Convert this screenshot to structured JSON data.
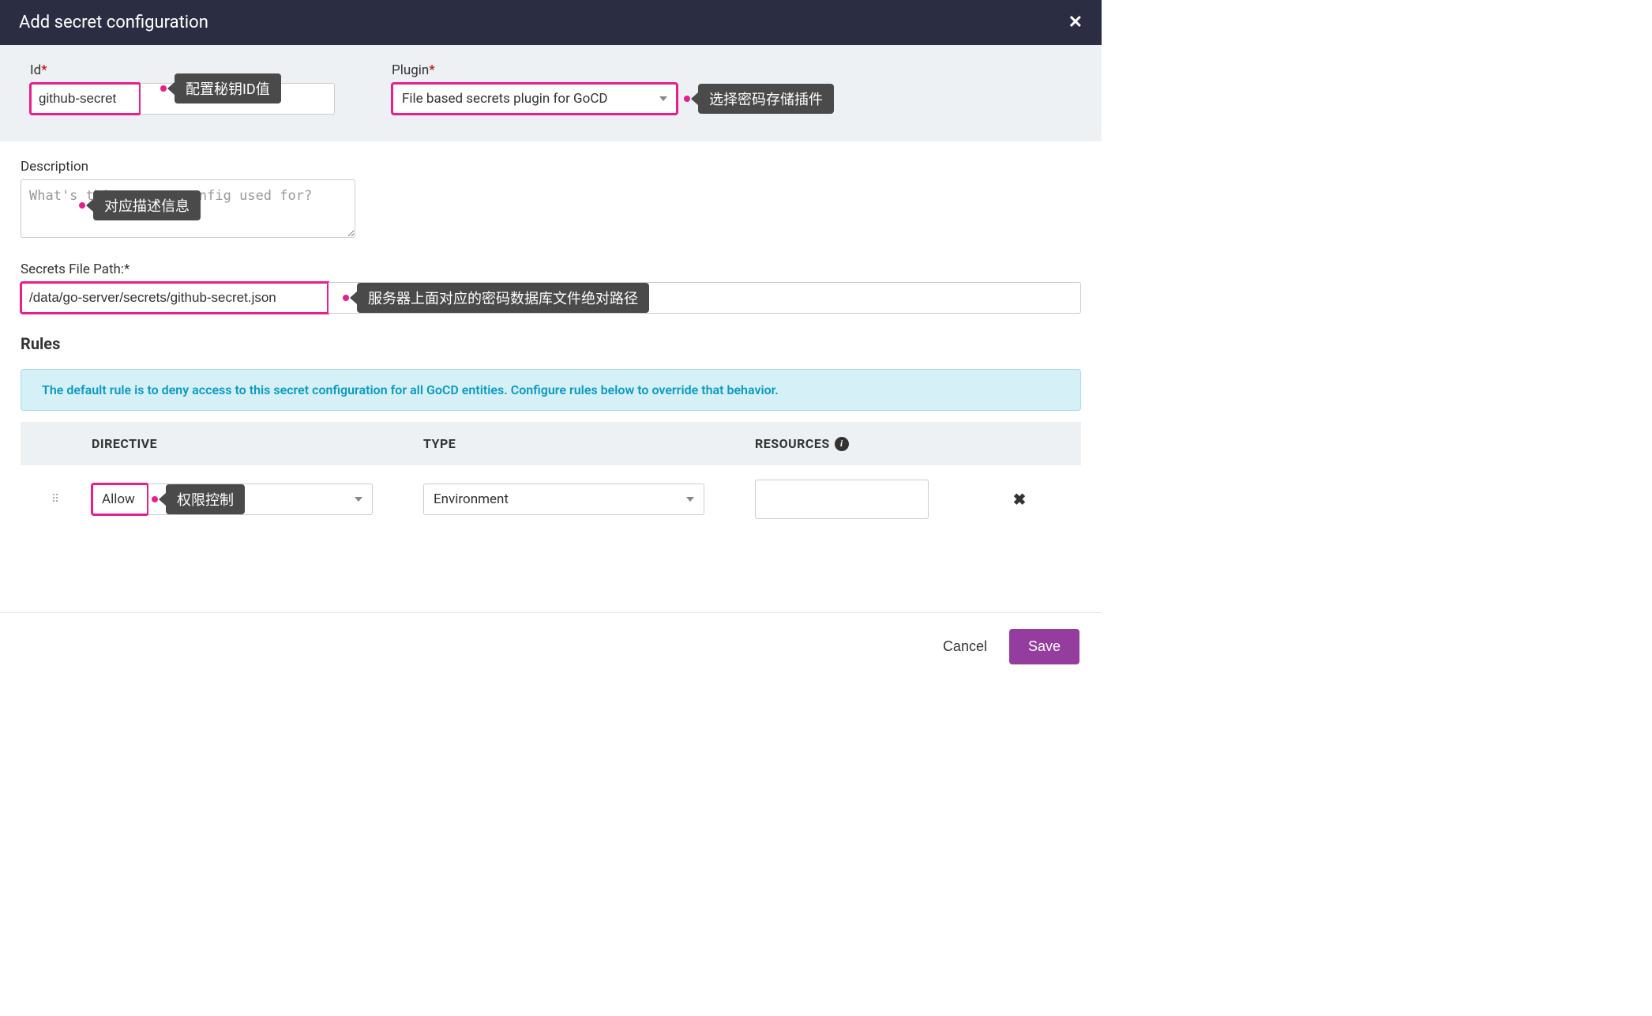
{
  "modal": {
    "title": "Add secret configuration",
    "close_icon": "✕"
  },
  "fields": {
    "id": {
      "label": "Id",
      "required_mark": "*",
      "value": "github-secret",
      "annotation": "配置秘钥ID值"
    },
    "plugin": {
      "label": "Plugin",
      "required_mark": "*",
      "selected": "File based secrets plugin for GoCD",
      "annotation": "选择密码存储插件"
    },
    "description": {
      "label": "Description",
      "placeholder": "What's this secret config used for?",
      "value": "",
      "annotation": "对应描述信息"
    },
    "secrets_file_path": {
      "label": "Secrets File Path:*",
      "value": "/data/go-server/secrets/github-secret.json",
      "annotation": "服务器上面对应的密码数据库文件绝对路径"
    }
  },
  "rules": {
    "heading": "Rules",
    "info": "The default rule is to deny access to this secret configuration for all GoCD entities. Configure rules below to override that behavior.",
    "columns": {
      "directive": "DIRECTIVE",
      "type": "TYPE",
      "resources": "RESOURCES"
    },
    "rows": [
      {
        "directive": "Allow",
        "directive_annotation": "权限控制",
        "type": "Environment",
        "resource": ""
      }
    ]
  },
  "footer": {
    "cancel": "Cancel",
    "save": "Save"
  }
}
